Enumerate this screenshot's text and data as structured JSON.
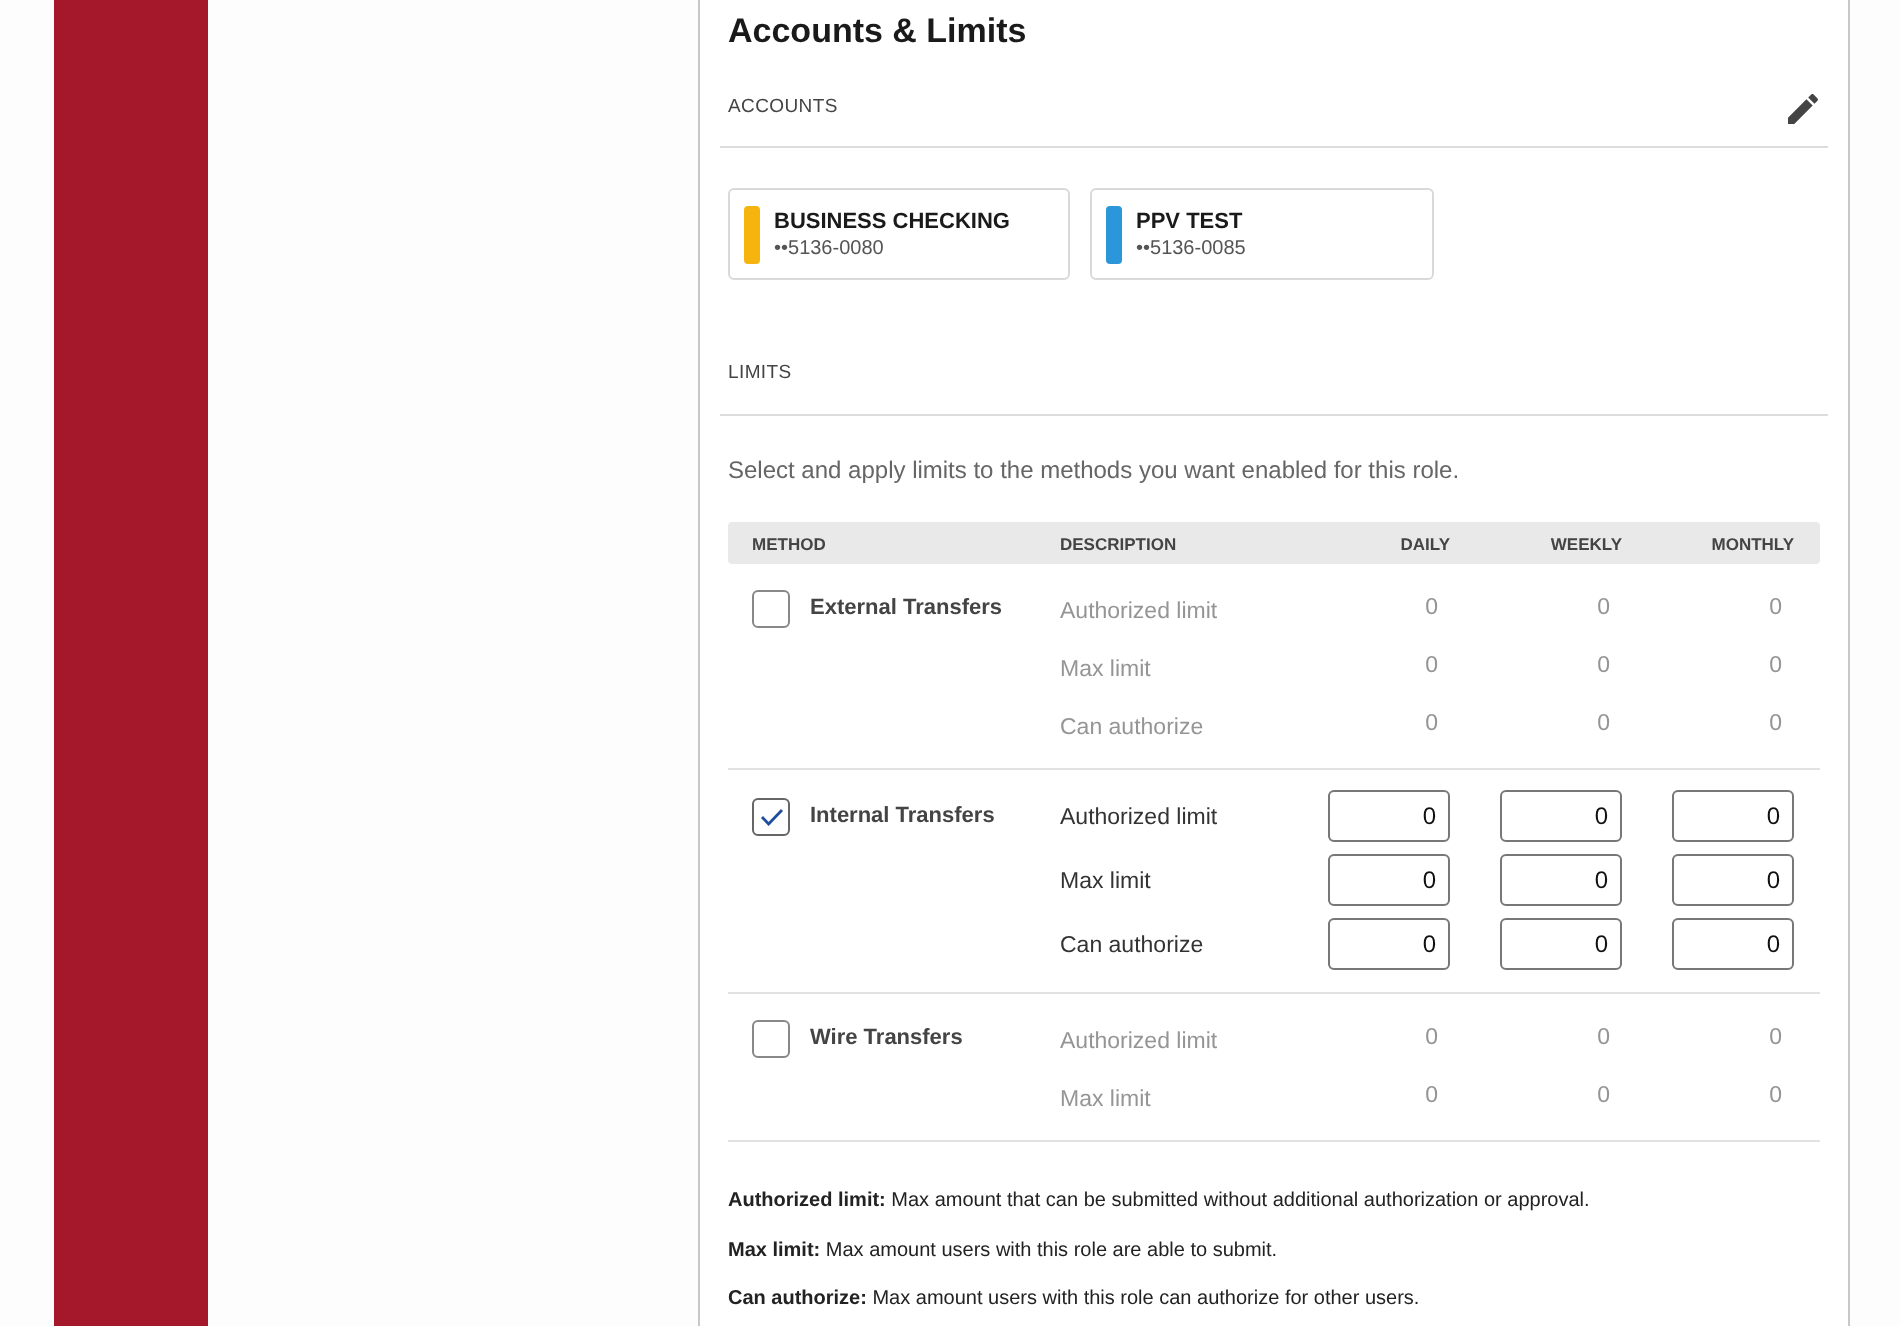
{
  "page": {
    "title": "Accounts & Limits"
  },
  "accounts_section": {
    "heading": "ACCOUNTS",
    "accounts": [
      {
        "name": "BUSINESS CHECKING",
        "number": "••5136-0080",
        "color": "#f6b40e"
      },
      {
        "name": "PPV TEST",
        "number": "••5136-0085",
        "color": "#2b96d9"
      }
    ]
  },
  "limits_section": {
    "heading": "LIMITS",
    "intro": "Select and apply limits to the methods you want enabled for this role.",
    "table": {
      "columns": [
        "METHOD",
        "DESCRIPTION",
        "DAILY",
        "WEEKLY",
        "MONTHLY"
      ],
      "methods": [
        {
          "name": "External Transfers",
          "checked": false,
          "limits": [
            {
              "description": "Authorized limit",
              "values": [
                "0",
                "0",
                "0"
              ]
            },
            {
              "description": "Max limit",
              "values": [
                "0",
                "0",
                "0"
              ]
            },
            {
              "description": "Can authorize",
              "values": [
                "0",
                "0",
                "0"
              ]
            }
          ]
        },
        {
          "name": "Internal Transfers",
          "checked": true,
          "limits": [
            {
              "description": "Authorized limit",
              "values": [
                "0",
                "0",
                "0"
              ]
            },
            {
              "description": "Max limit",
              "values": [
                "0",
                "0",
                "0"
              ]
            },
            {
              "description": "Can authorize",
              "values": [
                "0",
                "0",
                "0"
              ]
            }
          ]
        },
        {
          "name": "Wire Transfers",
          "checked": false,
          "limits": [
            {
              "description": "Authorized limit",
              "values": [
                "0",
                "0",
                "0"
              ]
            },
            {
              "description": "Max limit",
              "values": [
                "0",
                "0",
                "0"
              ]
            }
          ]
        }
      ]
    }
  },
  "footnotes": [
    "**Authorized limit:** Max amount that can be submitted without additional authorization or approval.",
    "**Max limit:** Max amount users with this role are able to submit.",
    "**Can authorize:** Max amount users with this role can authorize for other users."
  ]
}
